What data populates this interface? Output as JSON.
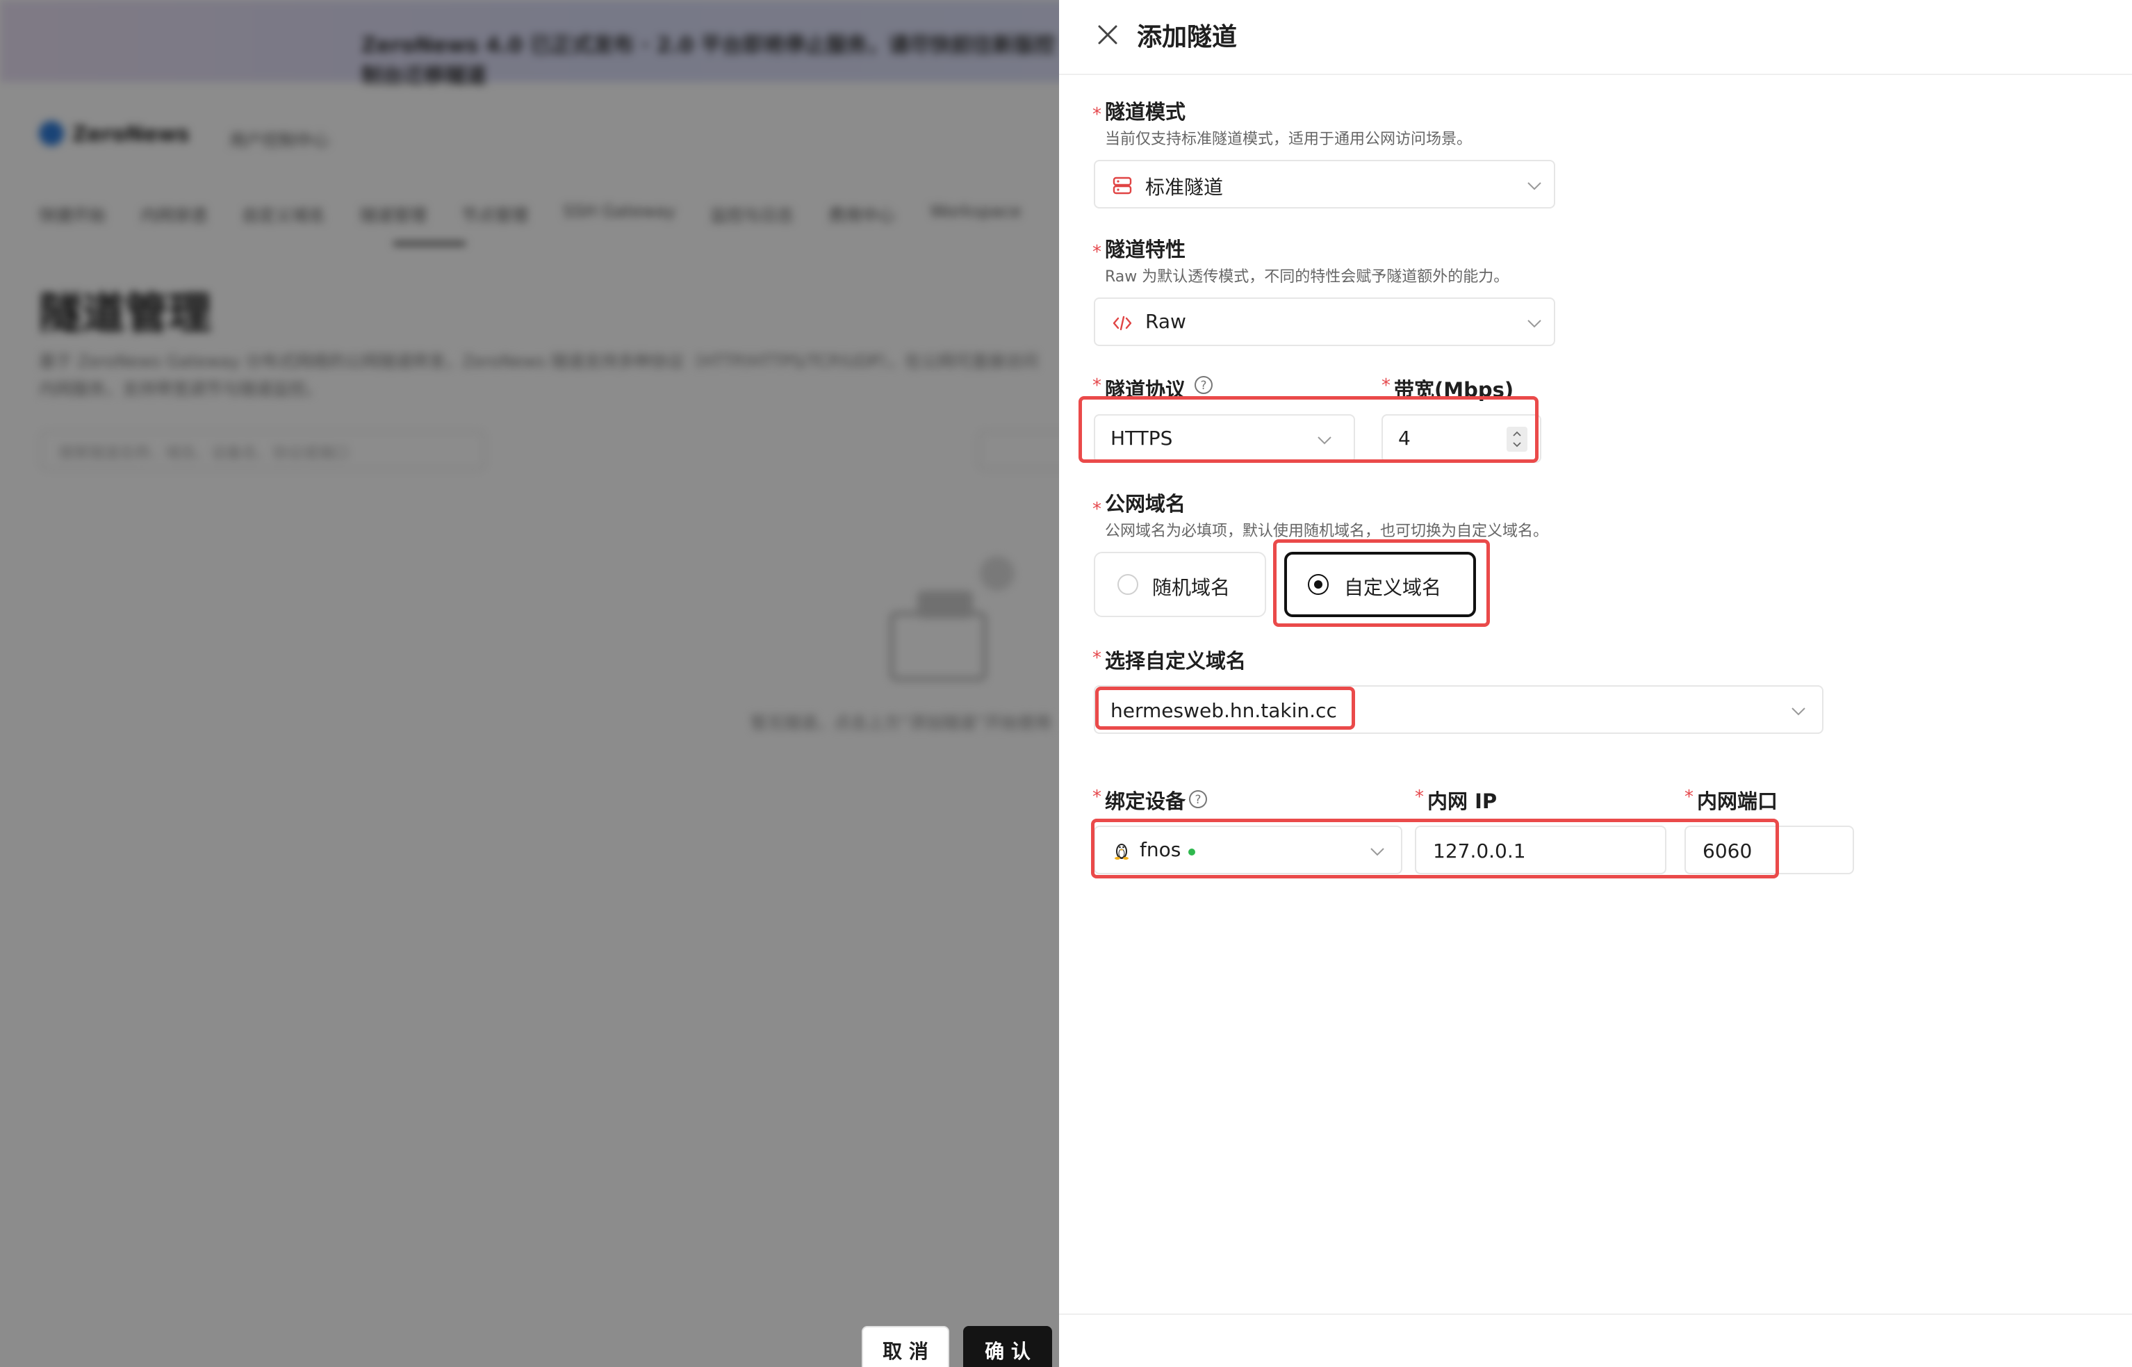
{
  "background": {
    "banner_text": "ZeroNews 4.0 已正式发布 · 2.0 平台即将停止服务，请尽快前往新版控制台迁移隧道",
    "brand": "ZeroNews",
    "brand_sub": "用户控制中心",
    "nav": [
      "快捷开始",
      "内网穿透",
      "自定义域名",
      "隧道管理",
      "节点管理",
      "SSH Gateway",
      "监控与日志",
      "费用中心",
      "Workspace"
    ],
    "title": "隧道管理",
    "description": "基于 ZeroNews Gateway 分布式网络的公网隧道转发，ZeroNews 隧道支持多种协议（HTTP/HTTPS/TCP/UDP），在公网可直接访问内网服务，支持带宽调节与隧道监控。",
    "search_placeholder": "搜索隧道名称、域名、设备名、协议或端口",
    "empty_text": "暂无隧道，点击上方“添加隧道”开始使用"
  },
  "drawer": {
    "title": "添加隧道",
    "tunnel_mode": {
      "label": "隧道模式",
      "hint": "当前仅支持标准隧道模式，适用于通用公网访问场景。",
      "value": "标准隧道",
      "icon": "server-icon"
    },
    "tunnel_feature": {
      "label": "隧道特性",
      "hint": "Raw 为默认透传模式，不同的特性会赋予隧道额外的能力。",
      "value": "Raw",
      "icon": "code-icon"
    },
    "protocol": {
      "label": "隧道协议",
      "value": "HTTPS"
    },
    "bandwidth": {
      "label": "带宽(Mbps)",
      "value": "4"
    },
    "public_domain": {
      "label": "公网域名",
      "hint": "公网域名为必填项，默认使用随机域名，也可切换为自定义域名。",
      "options": [
        "随机域名",
        "自定义域名"
      ],
      "selected": "自定义域名"
    },
    "custom_domain": {
      "label": "选择自定义域名",
      "value": "hermesweb.hn.takin.cc"
    },
    "bind_device": {
      "label": "绑定设备",
      "value": "fnos",
      "status_color": "#2fb84e",
      "icon": "linux-penguin-icon"
    },
    "lan_ip": {
      "label": "内网 IP",
      "value": "127.0.0.1"
    },
    "lan_port": {
      "label": "内网端口",
      "value": "6060"
    },
    "cancel_label": "取 消",
    "confirm_label": "确 认"
  },
  "colors": {
    "required": "#e5484d",
    "highlight": "#ea4a4a",
    "primary_button": "#141414",
    "icon_red": "#e04444"
  }
}
